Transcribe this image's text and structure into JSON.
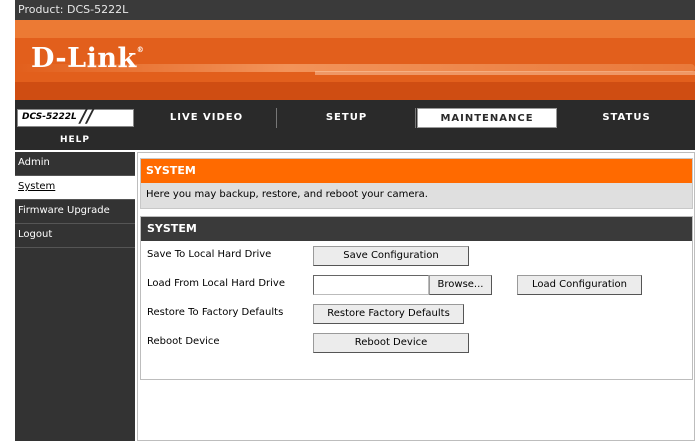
{
  "header": {
    "product_label": "Product: DCS-5222L",
    "logo_text": "D-Link",
    "logo_mark": "®"
  },
  "nav": {
    "model": "DCS-5222L",
    "tabs": [
      {
        "label": "LIVE VIDEO"
      },
      {
        "label": "SETUP"
      },
      {
        "label": "MAINTENANCE",
        "active": true
      },
      {
        "label": "STATUS"
      }
    ],
    "help": "HELP"
  },
  "sidebar": {
    "items": [
      {
        "label": "Admin"
      },
      {
        "label": "System",
        "active": true
      },
      {
        "label": "Firmware Upgrade"
      },
      {
        "label": "Logout"
      }
    ]
  },
  "intro": {
    "title": "SYSTEM",
    "description": "Here you may backup, restore, and reboot your camera."
  },
  "system": {
    "title": "SYSTEM",
    "save": {
      "label": "Save To Local Hard Drive",
      "button": "Save Configuration"
    },
    "load": {
      "label": "Load From Local Hard Drive",
      "file_value": "",
      "browse": "Browse...",
      "button": "Load Configuration"
    },
    "restore": {
      "label": "Restore To Factory Defaults",
      "button": "Restore Factory Defaults"
    },
    "reboot": {
      "label": "Reboot Device",
      "button": "Reboot Device"
    }
  },
  "colors": {
    "accent_orange": "#ff6a00",
    "banner_orange": "#e25f1c",
    "dark_bar": "#3a3a3a"
  }
}
